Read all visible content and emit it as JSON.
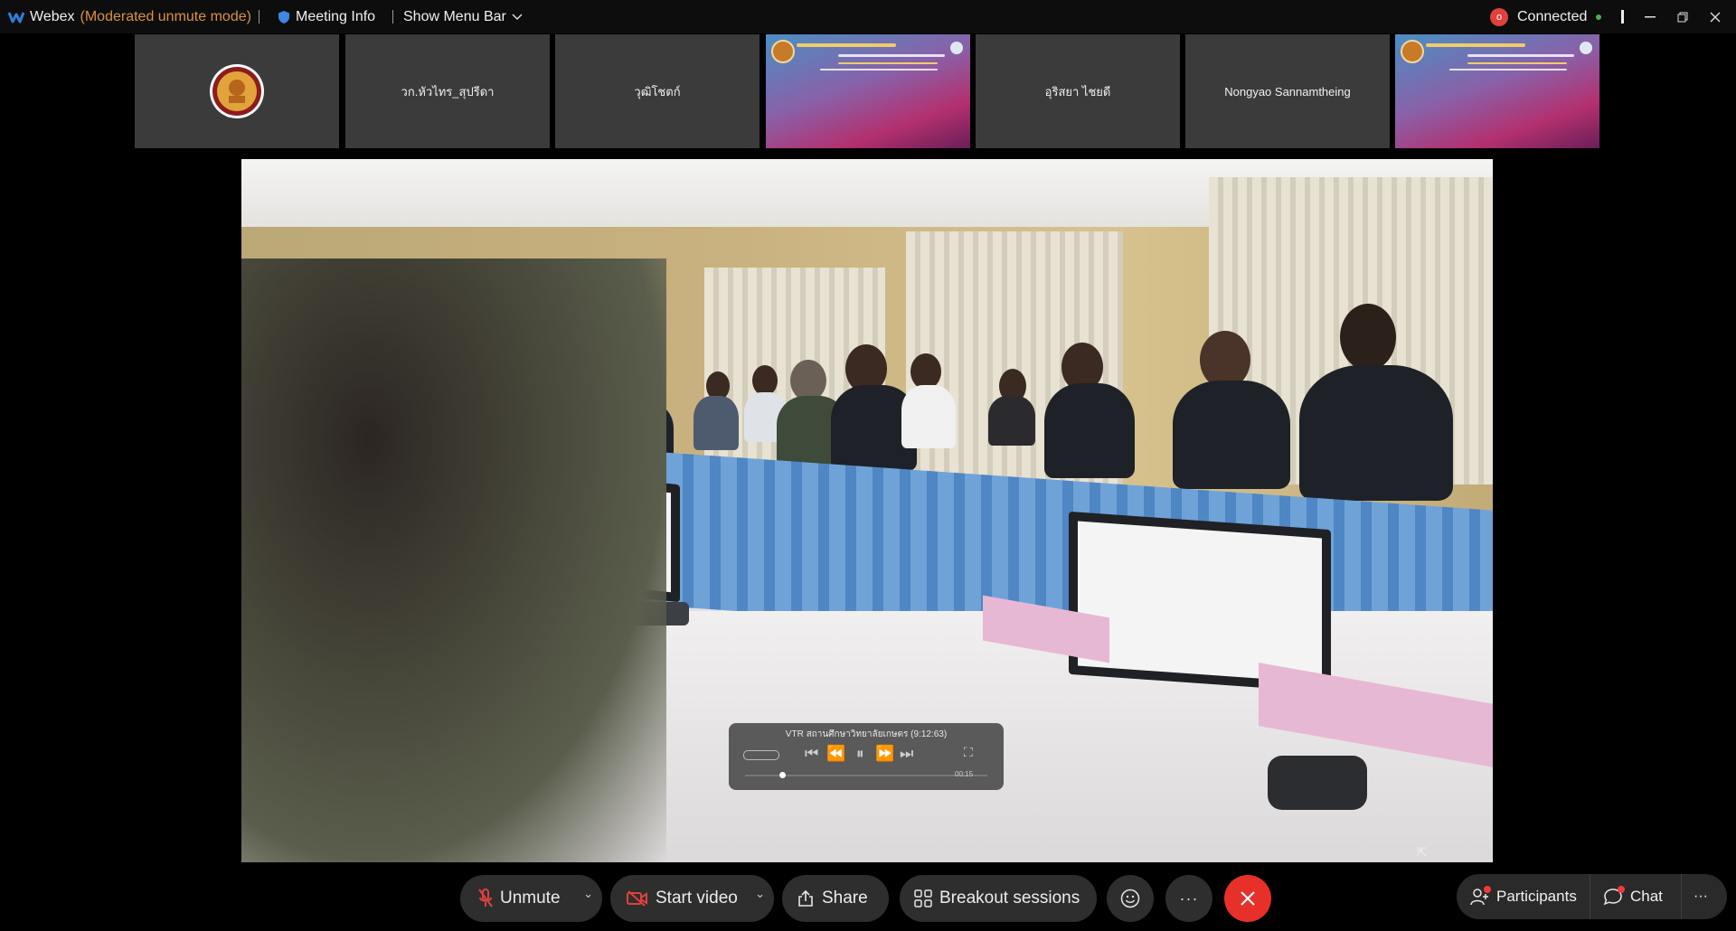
{
  "titlebar": {
    "app_name": "Webex",
    "mode": "(Moderated unmute mode)",
    "meeting_info": "Meeting Info",
    "show_menu_bar": "Show Menu Bar",
    "connection_status": "Connected",
    "record_badge": "o"
  },
  "thumbnails": [
    {
      "type": "logo",
      "label": ""
    },
    {
      "type": "name",
      "label": "วก.หัวไทร_สุปรีดา"
    },
    {
      "type": "name",
      "label": "วุฒิโชตก์"
    },
    {
      "type": "slide",
      "label": ""
    },
    {
      "type": "name",
      "label": "อุริสยา ไชยดี"
    },
    {
      "type": "name",
      "label": "Nongyao Sannamtheing"
    },
    {
      "type": "slide",
      "label": ""
    }
  ],
  "player": {
    "title": "VTR สถานศึกษาวิทยาลัยเกษตร (9:12:63)",
    "time": "00:15"
  },
  "controls": {
    "unmute": "Unmute",
    "start_video": "Start video",
    "share": "Share",
    "breakout": "Breakout sessions",
    "participants": "Participants",
    "chat": "Chat"
  },
  "colors": {
    "end_call": "#e8302a",
    "mute_icon": "#e0413c",
    "connected_dot": "#4caf50",
    "mode_text": "#d9923e"
  },
  "icons": [
    "webex-logo-icon",
    "shield-icon",
    "chevron-down-icon",
    "minimize-icon",
    "restore-icon",
    "close-icon",
    "mic-muted-icon",
    "video-off-icon",
    "share-icon",
    "breakout-icon",
    "reactions-icon",
    "more-icon",
    "end-call-icon",
    "participants-icon",
    "chat-icon"
  ]
}
